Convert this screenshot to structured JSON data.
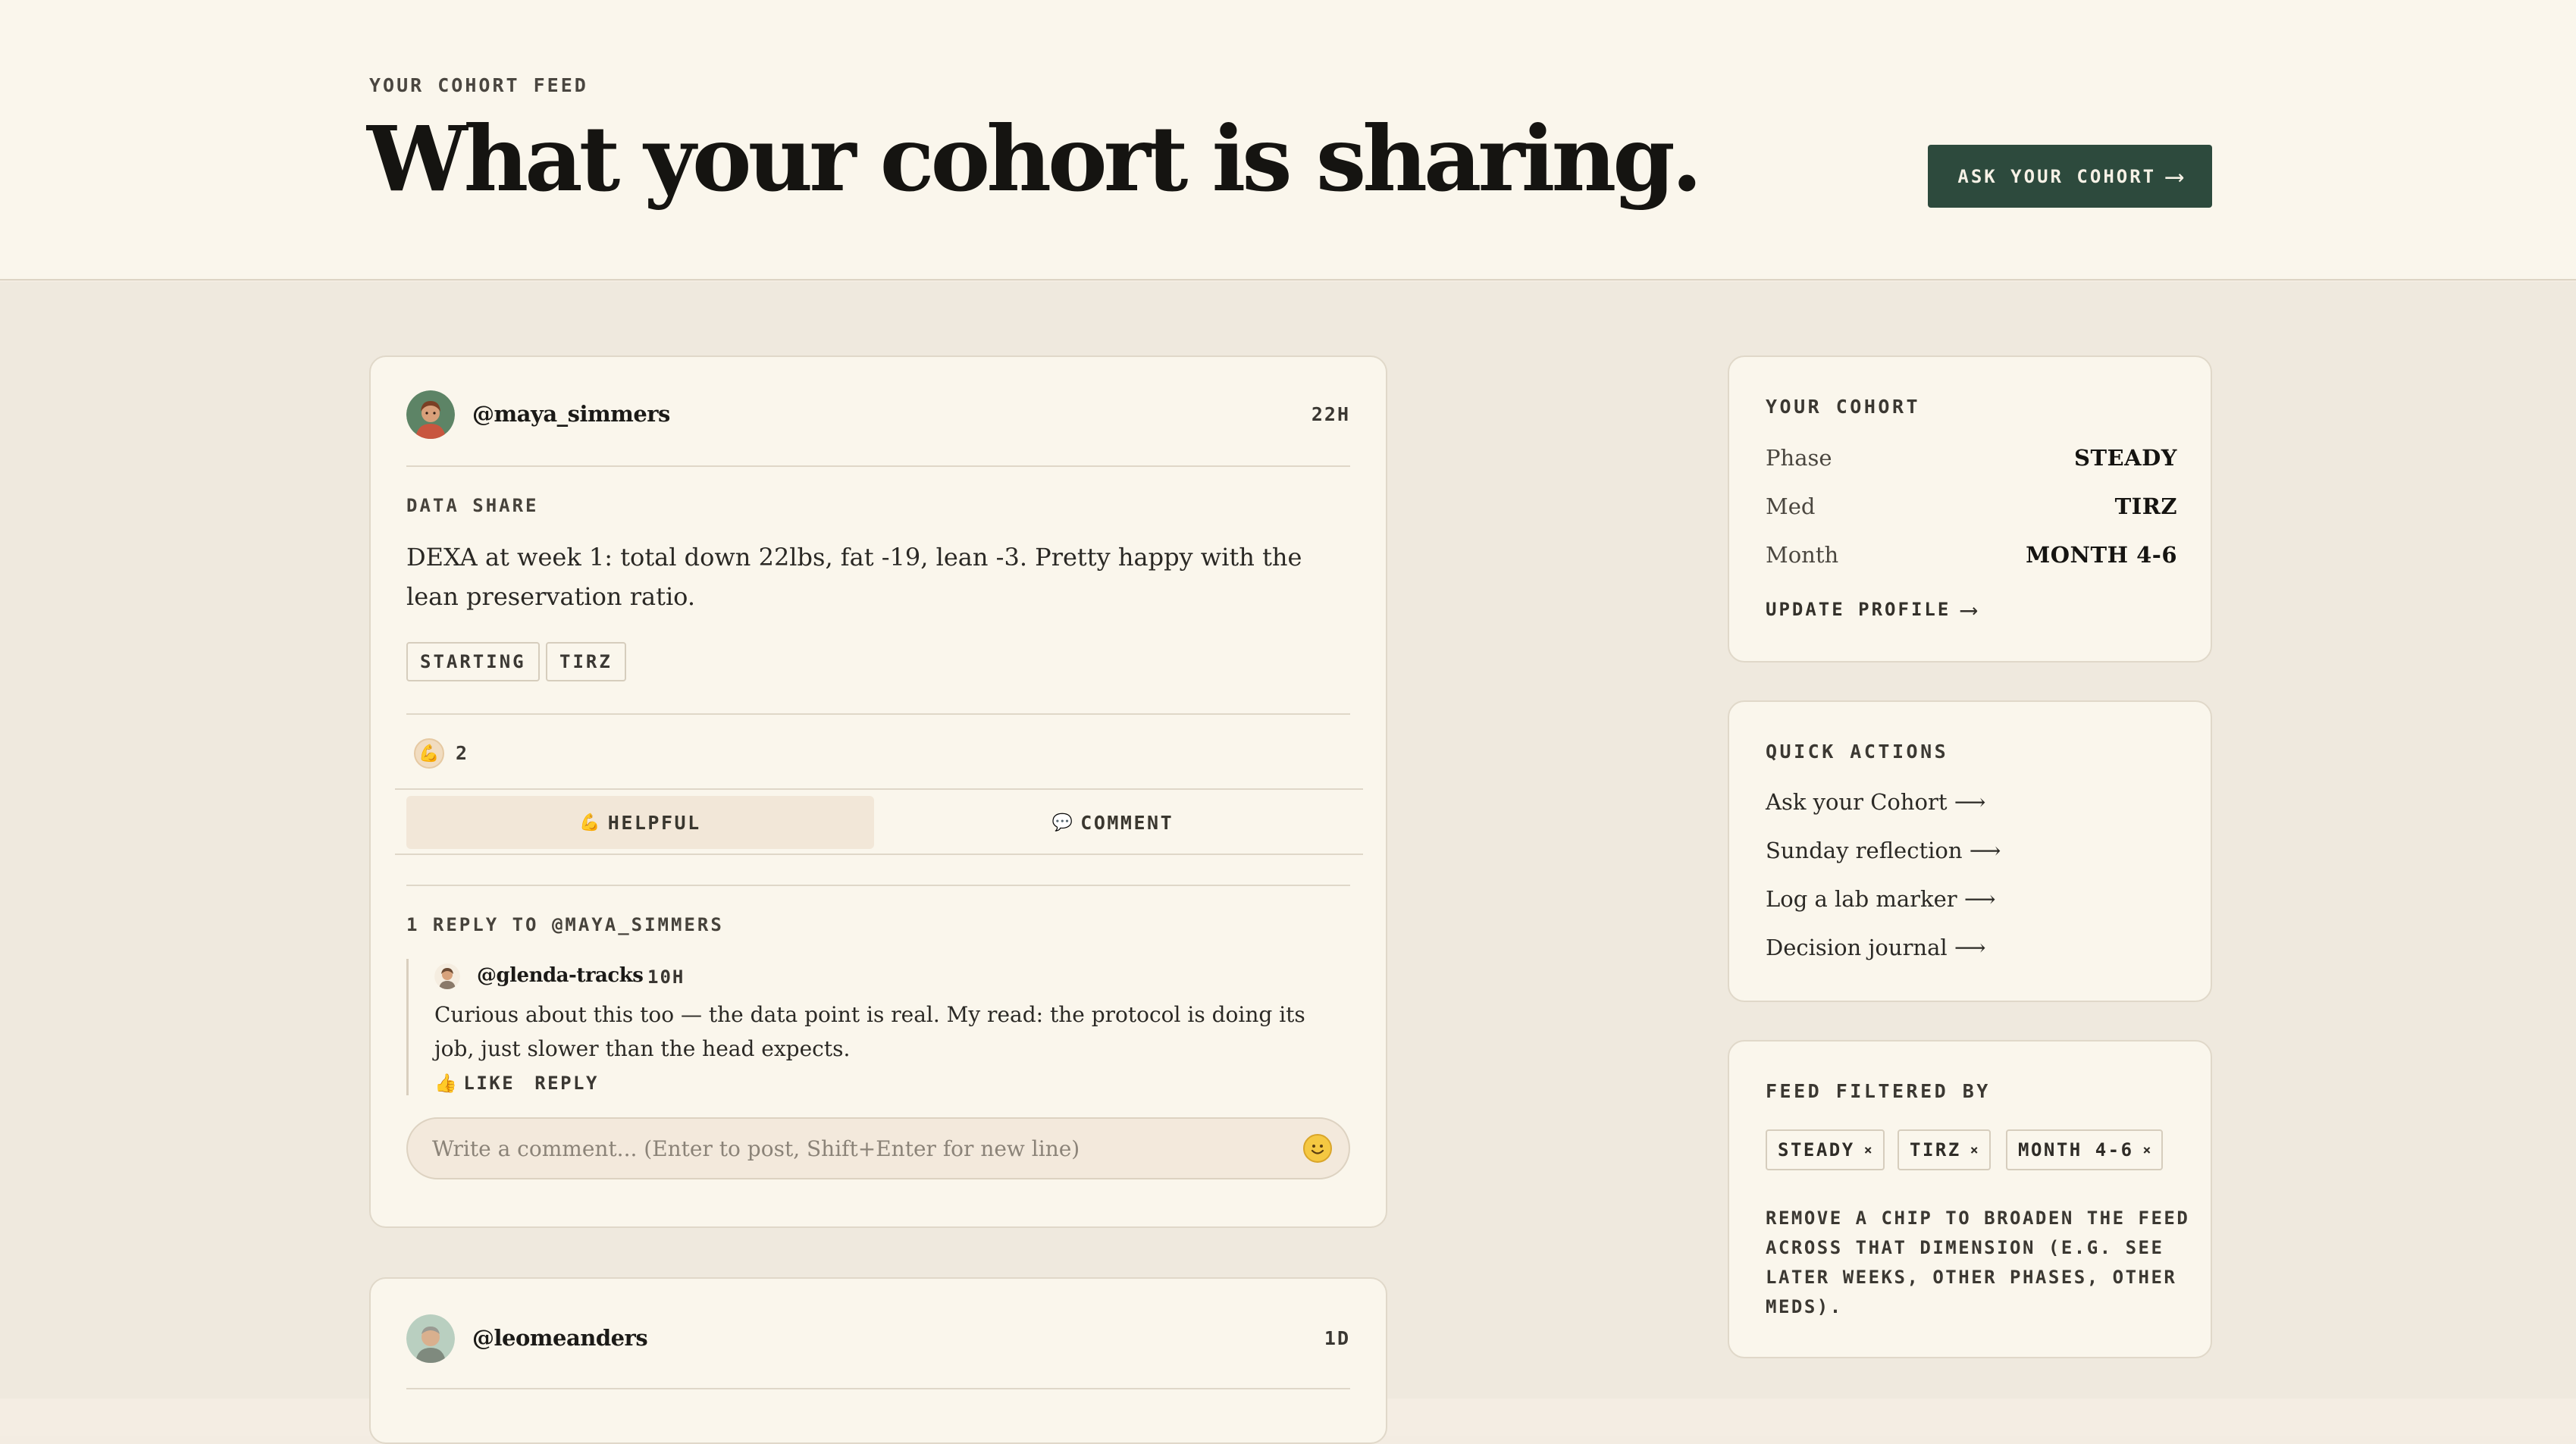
{
  "header": {
    "eyebrow": "YOUR COHORT FEED",
    "title": "What your cohort is sharing.",
    "ask_button": "ASK YOUR COHORT",
    "ask_arrow": "⟶"
  },
  "post": {
    "author": "@maya_simmers",
    "time": "22H",
    "type_label": "DATA SHARE",
    "body": "DEXA at week 1: total down 22lbs, fat -19, lean -3. Pretty happy with the lean preservation ratio.",
    "tags": [
      "STARTING",
      "TIRZ"
    ],
    "reaction_emoji": "💪",
    "reaction_count": "2",
    "helpful_icon": "💪",
    "helpful_label": "HELPFUL",
    "comment_icon": "💬",
    "comment_label": "COMMENT",
    "replies_header": "1 REPLY TO @MAYA_SIMMERS",
    "reply": {
      "author": "@glenda-tracks",
      "time": "10H",
      "text": "Curious about this too — the data point is real. My read: the protocol is doing its job, just slower than the head expects.",
      "like_icon": "👍",
      "like_label": "LIKE",
      "reply_label": "REPLY"
    },
    "comment_placeholder": "Write a comment... (Enter to post, Shift+Enter for new line)"
  },
  "post2": {
    "author": "@leomeanders",
    "time": "1D"
  },
  "sidebar": {
    "cohort": {
      "title": "YOUR COHORT",
      "rows": [
        {
          "key": "Phase",
          "value": "STEADY"
        },
        {
          "key": "Med",
          "value": "TIRZ"
        },
        {
          "key": "Month",
          "value": "MONTH 4-6"
        }
      ],
      "update_link": "UPDATE PROFILE",
      "arrow": "⟶"
    },
    "quick_actions": {
      "title": "QUICK ACTIONS",
      "items": [
        "Ask your Cohort ⟶",
        "Sunday reflection ⟶",
        "Log a lab marker ⟶",
        "Decision journal ⟶"
      ]
    },
    "filter": {
      "title": "FEED FILTERED BY",
      "chips": [
        "STEADY",
        "TIRZ",
        "MONTH 4-6"
      ],
      "chip_remove": "×",
      "note": "REMOVE A CHIP TO BROADEN THE FEED ACROSS THAT DIMENSION (E.G. SEE LATER WEEKS, OTHER PHASES, OTHER MEDS)."
    }
  },
  "colors": {
    "accent": "#2d4a3d",
    "page_bg": "#efe9de",
    "card_bg": "#faf6ec",
    "helpful_bg": "#f2e7d8"
  }
}
